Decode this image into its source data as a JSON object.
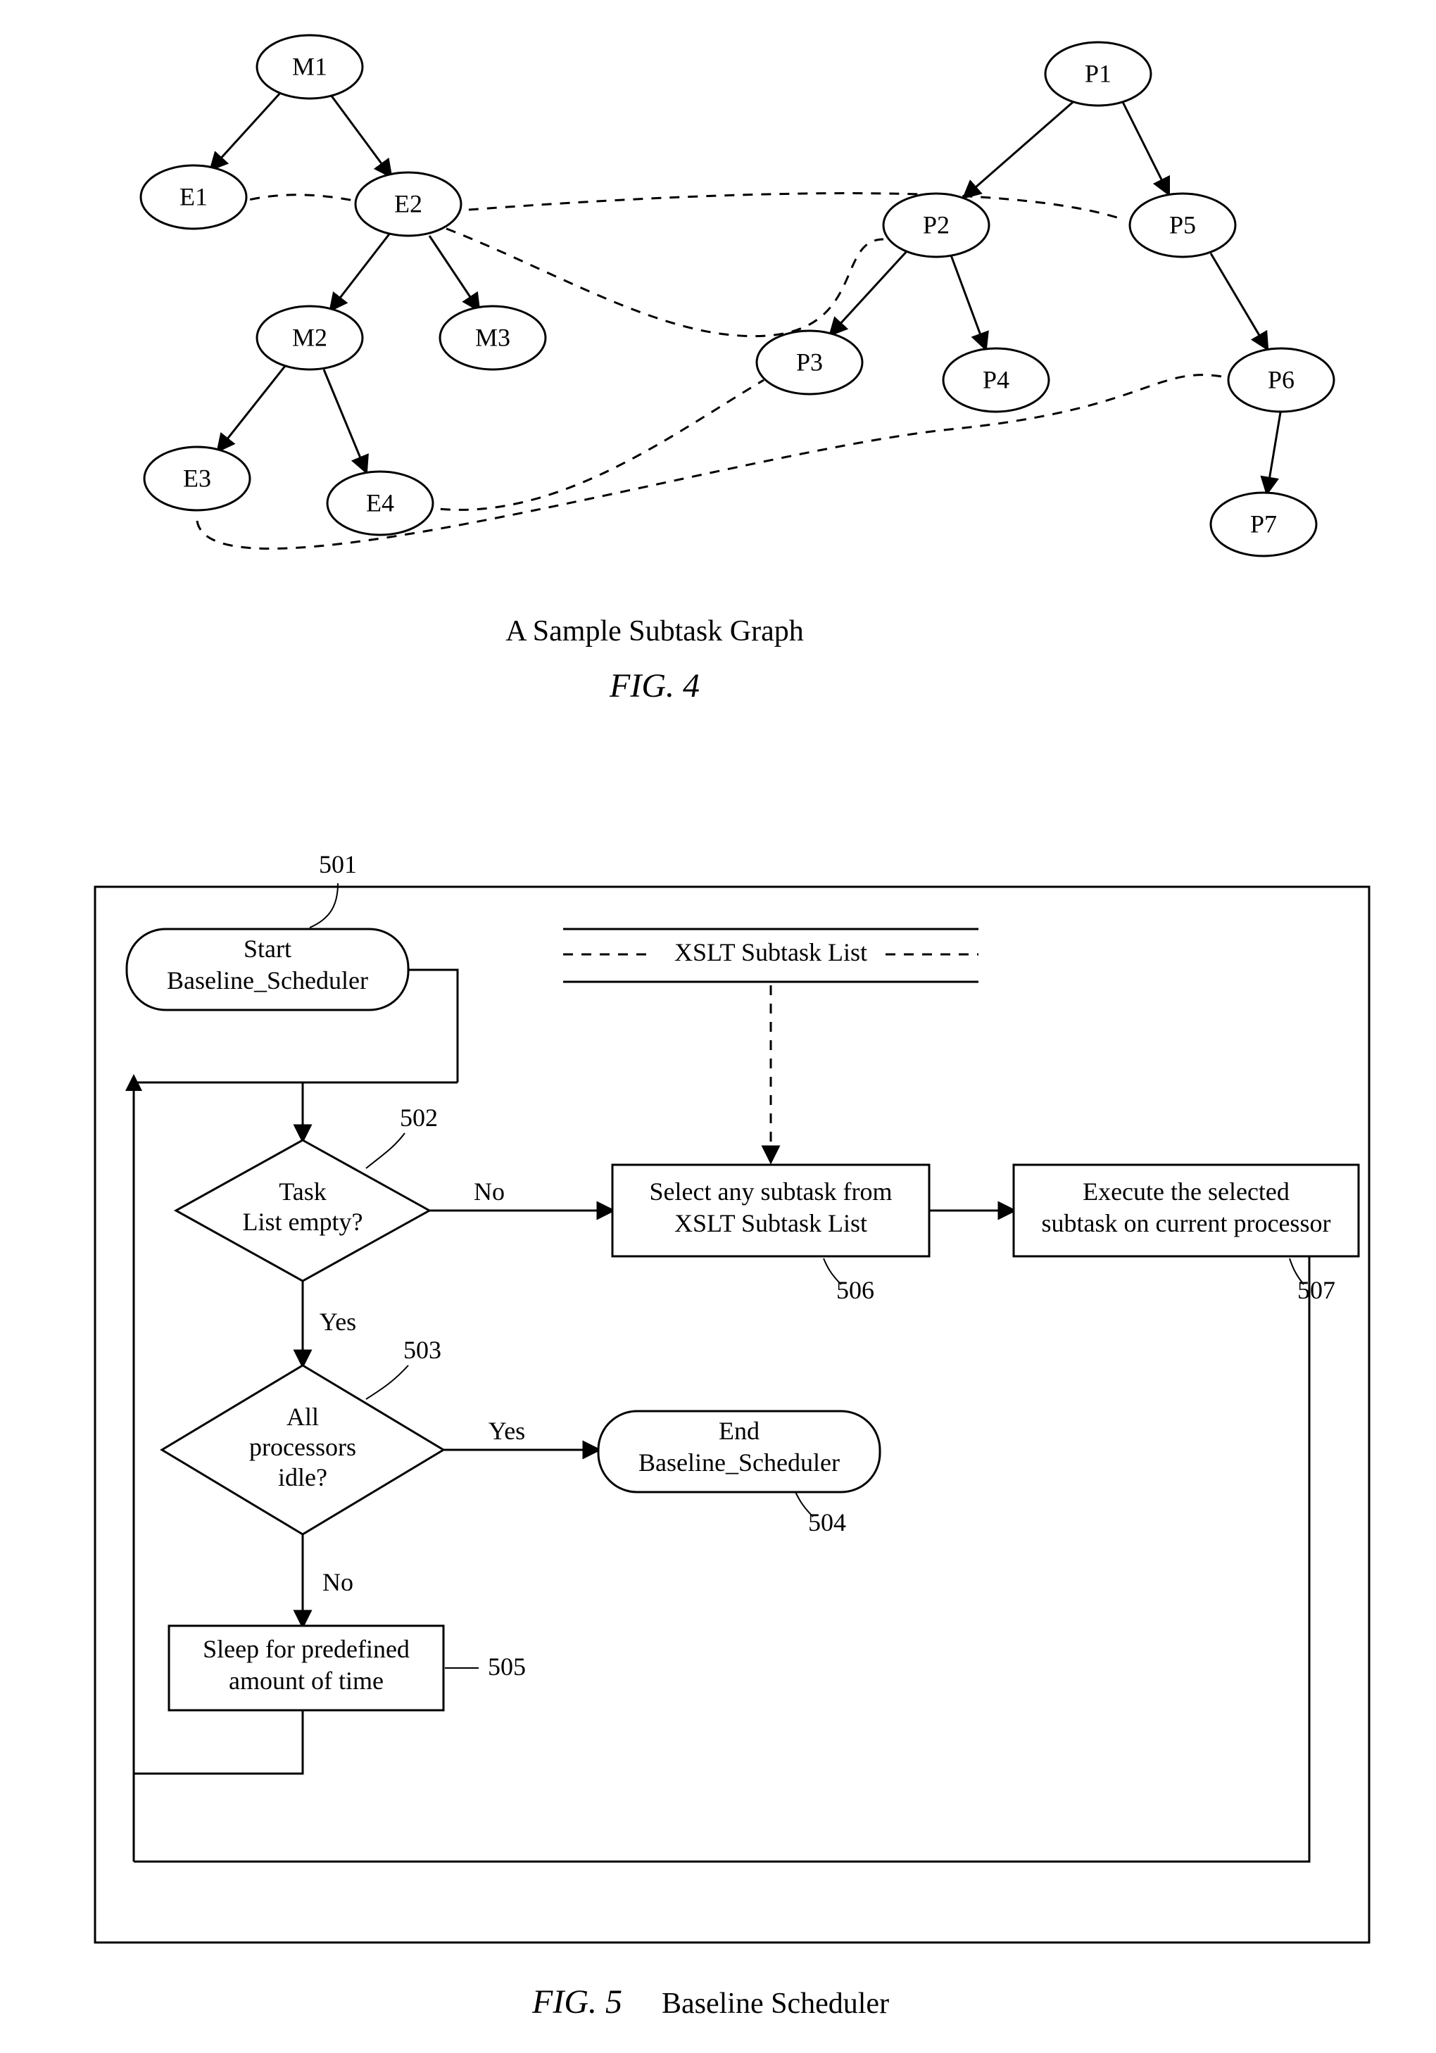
{
  "fig4": {
    "nodes": {
      "M1": "M1",
      "E1": "E1",
      "E2": "E2",
      "M2": "M2",
      "M3": "M3",
      "E3": "E3",
      "E4": "E4",
      "P1": "P1",
      "P2": "P2",
      "P3": "P3",
      "P4": "P4",
      "P5": "P5",
      "P6": "P6",
      "P7": "P7"
    },
    "caption": "A Sample Subtask Graph",
    "figlabel": "FIG. 4"
  },
  "fig5": {
    "refs": {
      "r501": "501",
      "r502": "502",
      "r503": "503",
      "r504": "504",
      "r505": "505",
      "r506": "506",
      "r507": "507"
    },
    "start": {
      "line1": "Start",
      "line2": "Baseline_Scheduler"
    },
    "xslt_header": "XSLT Subtask List",
    "task_empty": {
      "line1": "Task",
      "line2": "List empty?"
    },
    "all_idle": {
      "line1": "All",
      "line2": "processors",
      "line3": "idle?"
    },
    "end": {
      "line1": "End",
      "line2": "Baseline_Scheduler"
    },
    "sleep": {
      "line1": "Sleep for predefined",
      "line2": "amount of time"
    },
    "select": {
      "line1": "Select any subtask from",
      "line2": "XSLT Subtask List"
    },
    "execute": {
      "line1": "Execute the selected",
      "line2": "subtask on current processor"
    },
    "labels": {
      "yes": "Yes",
      "no": "No"
    },
    "figlabel": "FIG. 5",
    "figsub": "Baseline Scheduler"
  },
  "chart_data": {
    "type": "diagram",
    "figures": [
      {
        "id": "FIG. 4",
        "title": "A Sample Subtask Graph",
        "nodes": [
          "M1",
          "E1",
          "E2",
          "M2",
          "M3",
          "E3",
          "E4",
          "P1",
          "P2",
          "P3",
          "P4",
          "P5",
          "P6",
          "P7"
        ],
        "solid_edges": [
          [
            "M1",
            "E1"
          ],
          [
            "M1",
            "E2"
          ],
          [
            "E2",
            "M2"
          ],
          [
            "E2",
            "M3"
          ],
          [
            "M2",
            "E3"
          ],
          [
            "M2",
            "E4"
          ],
          [
            "P1",
            "P2"
          ],
          [
            "P1",
            "P5"
          ],
          [
            "P2",
            "P3"
          ],
          [
            "P2",
            "P4"
          ],
          [
            "P5",
            "P6"
          ],
          [
            "P6",
            "P7"
          ]
        ],
        "dashed_edges": [
          [
            "E1",
            "P2"
          ],
          [
            "E2",
            "P5"
          ],
          [
            "E3",
            "P6"
          ],
          [
            "E4",
            "P3"
          ]
        ]
      },
      {
        "id": "FIG. 5",
        "title": "Baseline Scheduler",
        "type": "flowchart",
        "blocks": {
          "501": {
            "shape": "terminal",
            "text": "Start Baseline_Scheduler"
          },
          "502": {
            "shape": "decision",
            "text": "Task List empty?"
          },
          "503": {
            "shape": "decision",
            "text": "All processors idle?"
          },
          "504": {
            "shape": "terminal",
            "text": "End Baseline_Scheduler"
          },
          "505": {
            "shape": "process",
            "text": "Sleep for predefined amount of time"
          },
          "506": {
            "shape": "process",
            "text": "Select any subtask from XSLT Subtask List"
          },
          "507": {
            "shape": "process",
            "text": "Execute the selected subtask on current processor"
          },
          "XSLT": {
            "shape": "datastore",
            "text": "XSLT Subtask List"
          }
        },
        "flows": [
          {
            "from": "501",
            "to": "502",
            "label": null
          },
          {
            "from": "502",
            "to": "506",
            "label": "No"
          },
          {
            "from": "502",
            "to": "503",
            "label": "Yes"
          },
          {
            "from": "503",
            "to": "504",
            "label": "Yes"
          },
          {
            "from": "503",
            "to": "505",
            "label": "No"
          },
          {
            "from": "505",
            "to": "502",
            "label": null,
            "loop_back": true
          },
          {
            "from": "506",
            "to": "507",
            "label": null
          },
          {
            "from": "507",
            "to": "502",
            "label": null,
            "loop_back": true
          },
          {
            "from": "XSLT",
            "to": "506",
            "label": null,
            "dashed": true
          }
        ]
      }
    ]
  }
}
